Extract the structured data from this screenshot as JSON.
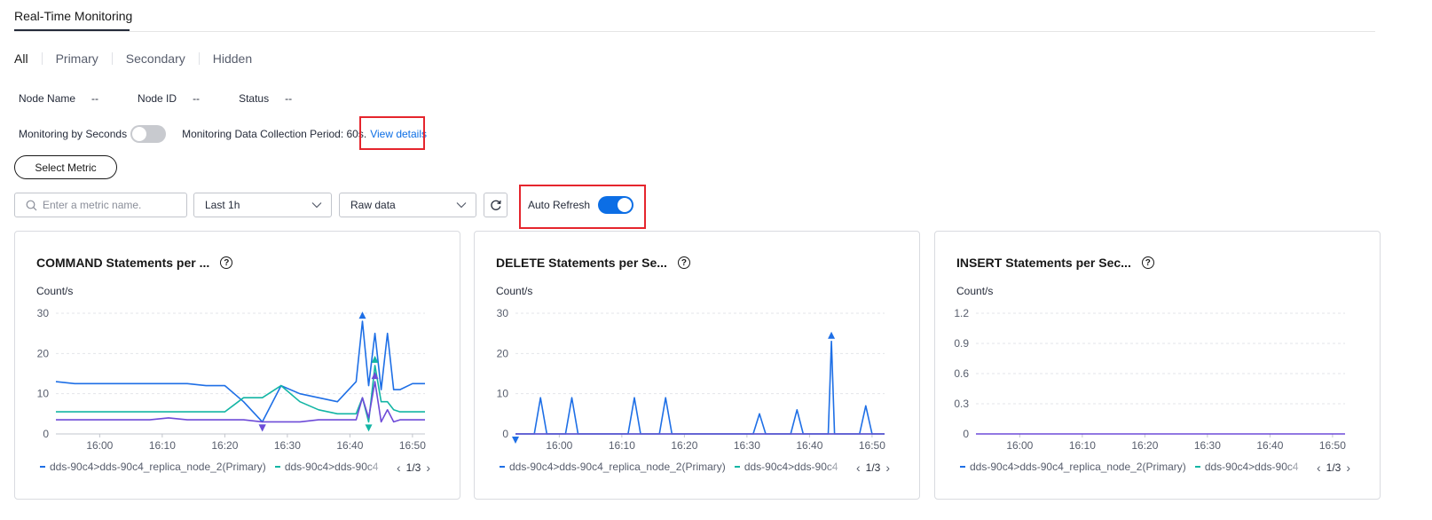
{
  "header": {
    "title": "Real-Time Monitoring"
  },
  "filters": {
    "tabs": [
      "All",
      "Primary",
      "Secondary",
      "Hidden"
    ],
    "active": "All"
  },
  "node_info": {
    "node_name_label": "Node Name",
    "node_name_value": "--",
    "node_id_label": "Node ID",
    "node_id_value": "--",
    "status_label": "Status",
    "status_value": "--"
  },
  "monitoring": {
    "by_seconds_label": "Monitoring by Seconds",
    "by_seconds_on": false,
    "period_text": "Monitoring Data Collection Period: 60s.",
    "view_details": "View details"
  },
  "select_metric_label": "Select Metric",
  "toolbar": {
    "search_placeholder": "Enter a metric name.",
    "time_range": "Last 1h",
    "data_type": "Raw data",
    "auto_refresh_label": "Auto Refresh",
    "auto_refresh_on": true
  },
  "colors": {
    "blue": "#1e6fe6",
    "teal": "#13b5a4",
    "purple": "#6e4bd8",
    "highlight": "#e5252d",
    "link": "#0c6ee5"
  },
  "legend": {
    "item1": "dds-90c4>dds-90c4_replica_node_2(Primary)",
    "item2": "dds-90c4>dds-90c4",
    "pager": "1/3"
  },
  "cards": [
    {
      "title": "COMMAND Statements per ...",
      "unit": "Count/s"
    },
    {
      "title": "DELETE Statements per Se...",
      "unit": "Count/s"
    },
    {
      "title": "INSERT Statements per Sec...",
      "unit": "Count/s"
    }
  ],
  "chart_data": [
    {
      "type": "line",
      "title": "COMMAND Statements per ...",
      "ylabel": "Count/s",
      "ylim": [
        0,
        30
      ],
      "yticks": [
        "30",
        "20",
        "10",
        "0"
      ],
      "xticks": [
        "16:00",
        "16:10",
        "16:20",
        "16:30",
        "16:40",
        "16:50"
      ],
      "x": [
        "15:53",
        "15:56",
        "15:59",
        "16:02",
        "16:05",
        "16:08",
        "16:11",
        "16:14",
        "16:17",
        "16:20",
        "16:23",
        "16:26",
        "16:29",
        "16:32",
        "16:35",
        "16:38",
        "16:41",
        "16:42",
        "16:43",
        "16:44",
        "16:45",
        "16:46",
        "16:47",
        "16:48",
        "16:50",
        "16:52"
      ],
      "series": [
        {
          "color": "#1e6fe6",
          "values": [
            13,
            12.5,
            12.5,
            12.5,
            12.5,
            12.5,
            12.5,
            12.5,
            12,
            12,
            8,
            3,
            12,
            10,
            9,
            8,
            13,
            28,
            12,
            25,
            11,
            25,
            11,
            11,
            12.5,
            12.5
          ]
        },
        {
          "color": "#13b5a4",
          "values": [
            5.5,
            5.5,
            5.5,
            5.5,
            5.5,
            5.5,
            5.5,
            5.5,
            5.5,
            5.5,
            9,
            9,
            12,
            8,
            6,
            5,
            5,
            9,
            3,
            17,
            8,
            8,
            6,
            5.5,
            5.5,
            5.5
          ]
        },
        {
          "color": "#6e4bd8",
          "values": [
            3.5,
            3.5,
            3.5,
            3.5,
            3.5,
            3.5,
            4,
            3.5,
            3.5,
            3.5,
            3.5,
            3,
            3,
            3,
            3.5,
            3.5,
            3.5,
            9,
            4,
            13,
            3,
            6,
            3,
            3.5,
            3.5,
            3.5
          ]
        }
      ]
    },
    {
      "type": "line",
      "title": "DELETE Statements per Se...",
      "ylabel": "Count/s",
      "ylim": [
        0,
        30
      ],
      "yticks": [
        "30",
        "20",
        "10",
        "0"
      ],
      "xticks": [
        "16:00",
        "16:10",
        "16:20",
        "16:30",
        "16:40",
        "16:50"
      ],
      "x": [
        "15:53",
        "15:56",
        "15:57",
        "15:58",
        "16:01",
        "16:02",
        "16:03",
        "16:11",
        "16:12",
        "16:13",
        "16:16",
        "16:17",
        "16:18",
        "16:31",
        "16:32",
        "16:33",
        "16:37",
        "16:38",
        "16:39",
        "16:43",
        "16:43.5",
        "16:44",
        "16:48",
        "16:49",
        "16:50",
        "16:52"
      ],
      "series": [
        {
          "color": "#1e6fe6",
          "values": [
            0,
            0,
            9,
            0,
            0,
            9,
            0,
            0,
            9,
            0,
            0,
            9,
            0,
            0,
            5,
            0,
            0,
            6,
            0,
            0,
            23,
            0,
            0,
            7,
            0,
            0
          ]
        },
        {
          "color": "#13b5a4",
          "values": [
            0,
            0,
            0,
            0,
            0,
            0,
            0,
            0,
            0,
            0,
            0,
            0,
            0,
            0,
            0,
            0,
            0,
            0,
            0,
            0,
            0,
            0,
            0,
            0,
            0,
            0
          ]
        },
        {
          "color": "#6e4bd8",
          "values": [
            0,
            0,
            0,
            0,
            0,
            0,
            0,
            0,
            0,
            0,
            0,
            0,
            0,
            0,
            0,
            0,
            0,
            0,
            0,
            0,
            0,
            0,
            0,
            0,
            0,
            0
          ]
        }
      ]
    },
    {
      "type": "line",
      "title": "INSERT Statements per Sec...",
      "ylabel": "Count/s",
      "ylim": [
        0,
        1.2
      ],
      "yticks": [
        "1.2",
        "0.9",
        "0.6",
        "0.3",
        "0"
      ],
      "xticks": [
        "16:00",
        "16:10",
        "16:20",
        "16:30",
        "16:40",
        "16:50"
      ],
      "x": [
        "15:53",
        "16:52"
      ],
      "series": [
        {
          "color": "#6e4bd8",
          "values": [
            0,
            0
          ]
        }
      ]
    }
  ]
}
